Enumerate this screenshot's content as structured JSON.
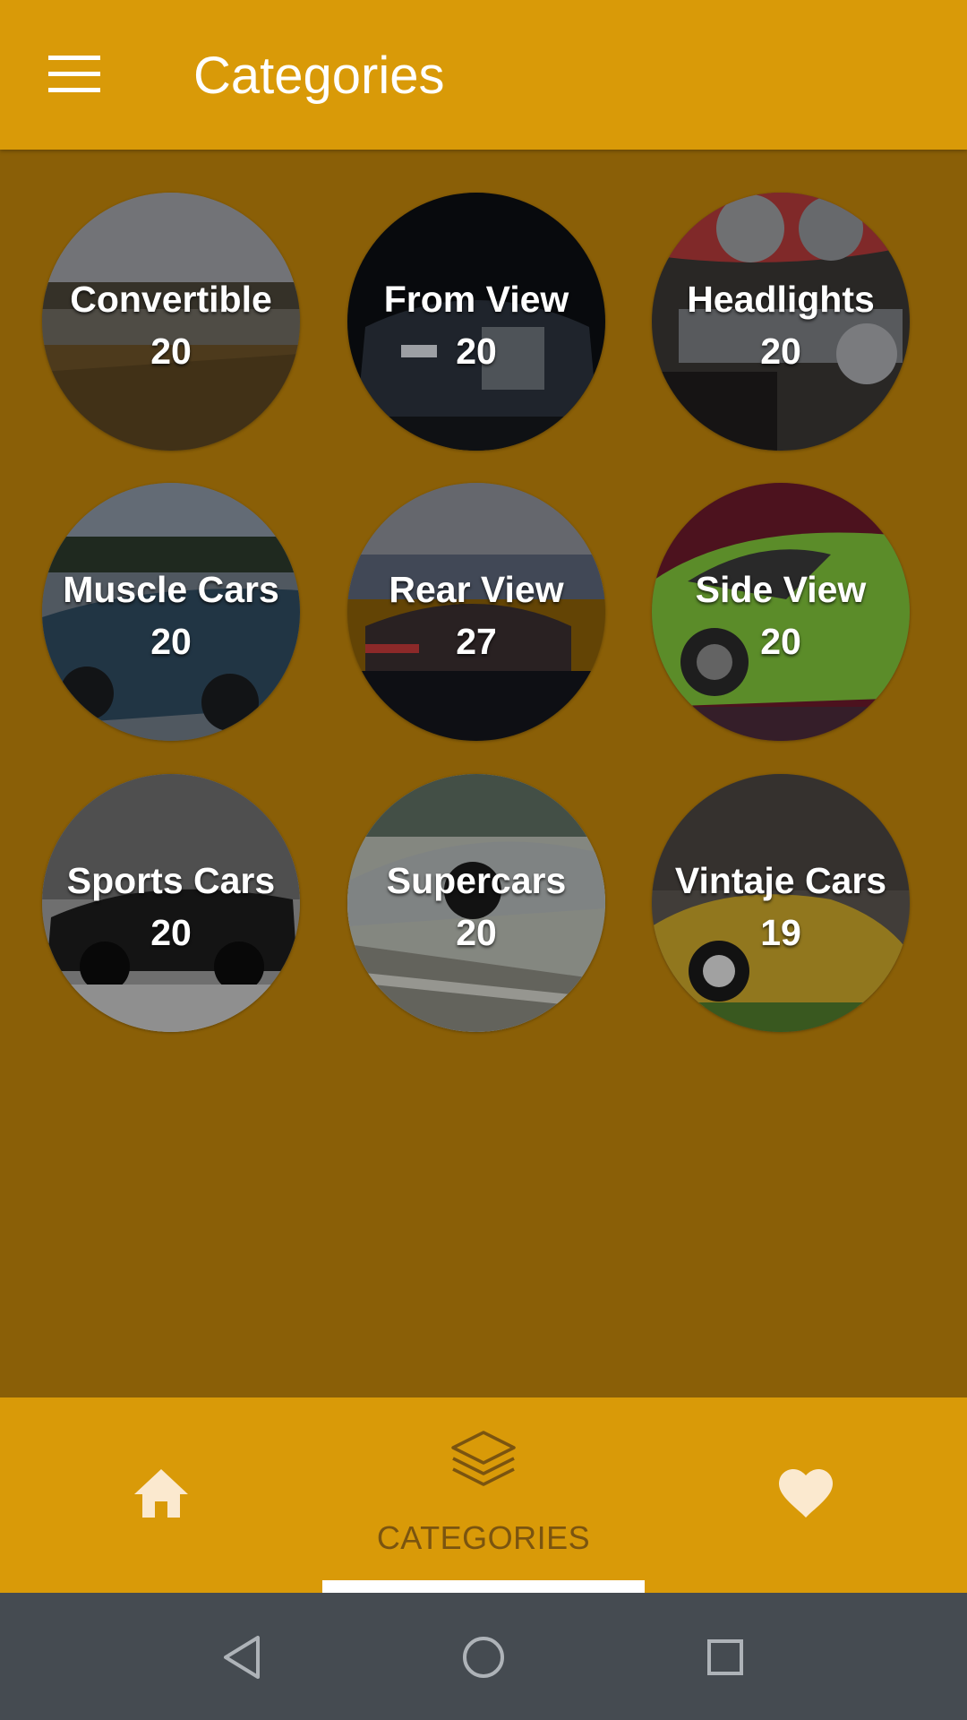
{
  "app_bar": {
    "menu_icon": "hamburger-menu-icon",
    "title": "Categories"
  },
  "categories": [
    {
      "name": "Convertible",
      "count": "20"
    },
    {
      "name": "From View",
      "count": "20"
    },
    {
      "name": "Headlights",
      "count": "20"
    },
    {
      "name": "Muscle Cars",
      "count": "20"
    },
    {
      "name": "Rear View",
      "count": "27"
    },
    {
      "name": "Side View",
      "count": "20"
    },
    {
      "name": "Sports Cars",
      "count": "20"
    },
    {
      "name": "Supercars",
      "count": "20"
    },
    {
      "name": "Vintaje Cars",
      "count": "19"
    }
  ],
  "bottom_nav": {
    "items": [
      {
        "icon": "home-icon",
        "label": ""
      },
      {
        "icon": "layers-icon",
        "label": "CATEGORIES",
        "selected": true
      },
      {
        "icon": "heart-icon",
        "label": ""
      }
    ]
  },
  "system_nav": {
    "back_icon": "back-triangle-icon",
    "home_icon": "home-circle-icon",
    "recents_icon": "recents-square-icon"
  },
  "colors": {
    "app_bar": "#d99a08",
    "background": "#8a5f07",
    "active_label": "#7a5410",
    "system_nav": "#454b51",
    "text": "#ffffff"
  }
}
